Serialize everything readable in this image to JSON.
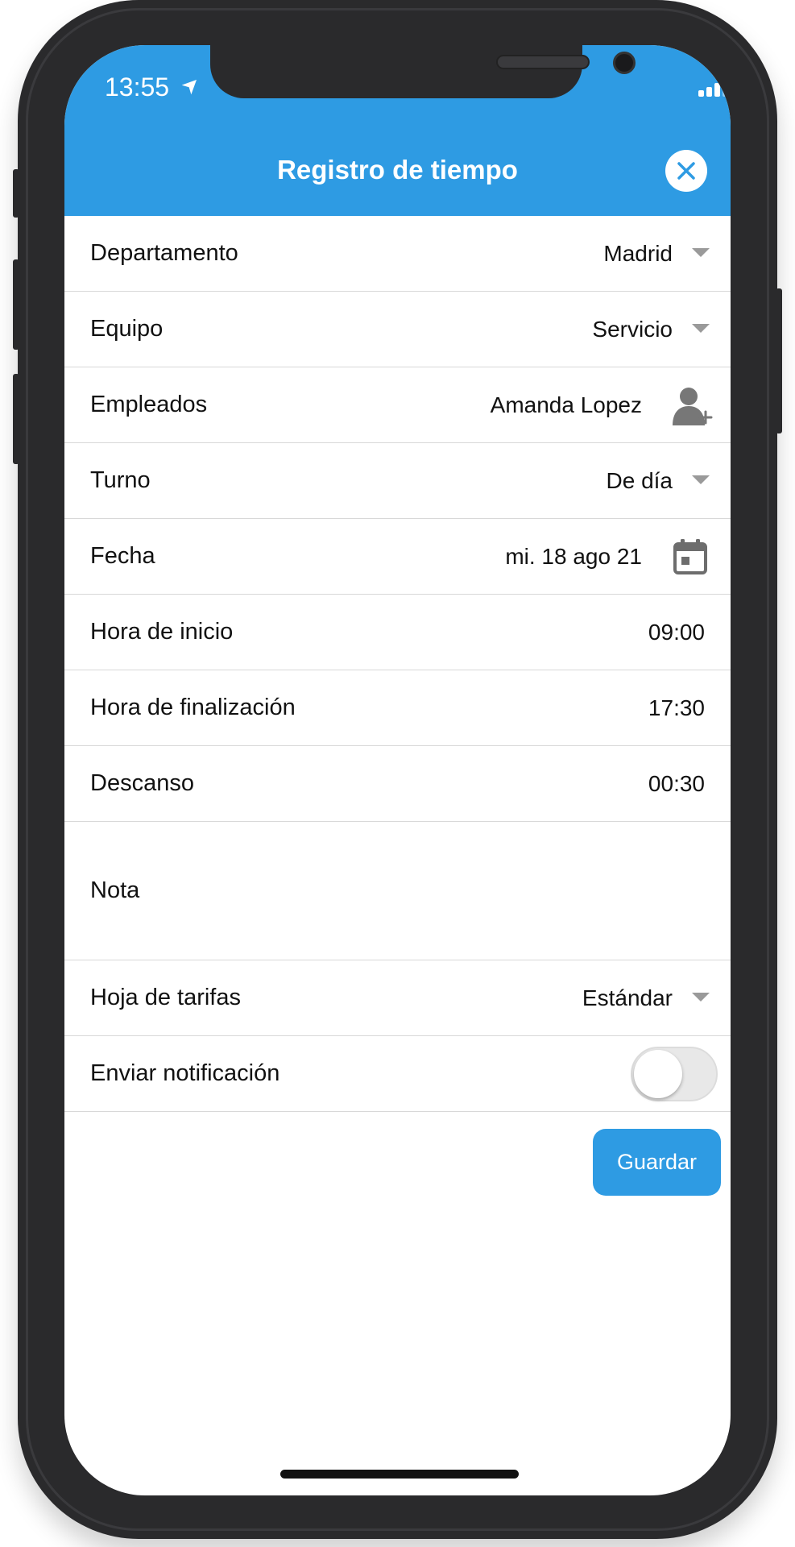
{
  "status": {
    "time": "13:55",
    "location_glyph": "➤"
  },
  "header": {
    "title": "Registro de tiempo",
    "close_glyph": "✕",
    "accent": "#2e9be3"
  },
  "form": {
    "department": {
      "label": "Departamento",
      "value": "Madrid"
    },
    "team": {
      "label": "Equipo",
      "value": "Servicio"
    },
    "employees": {
      "label": "Empleados",
      "value": "Amanda Lopez"
    },
    "shift": {
      "label": "Turno",
      "value": "De día"
    },
    "date": {
      "label": "Fecha",
      "value": "mi. 18 ago 21"
    },
    "start": {
      "label": "Hora de inicio",
      "value": "09:00"
    },
    "end": {
      "label": "Hora de finalización",
      "value": "17:30"
    },
    "break": {
      "label": "Descanso",
      "value": "00:30"
    },
    "note": {
      "label": "Nota",
      "value": ""
    },
    "rates": {
      "label": "Hoja de tarifas",
      "value": "Estándar"
    },
    "notify": {
      "label": "Enviar notificación",
      "enabled": false
    }
  },
  "actions": {
    "save_label": "Guardar"
  }
}
